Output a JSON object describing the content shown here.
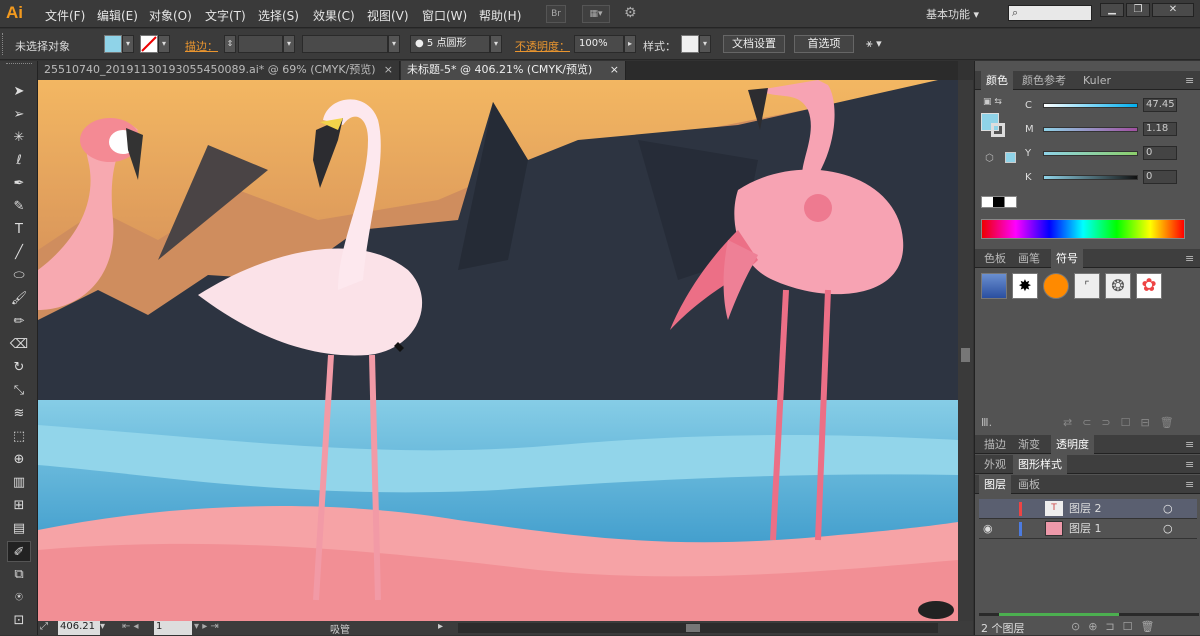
{
  "app": {
    "logo": "Ai",
    "workspace": "基本功能"
  },
  "menu": [
    "文件(F)",
    "编辑(E)",
    "对象(O)",
    "文字(T)",
    "选择(S)",
    "效果(C)",
    "视图(V)",
    "窗口(W)",
    "帮助(H)"
  ],
  "menubar_btn": "Br",
  "control": {
    "selection": "未选择对象",
    "stroke_label": "描边：",
    "brush": "5 点圆形",
    "opacity_label": "不透明度：",
    "opacity": "100%",
    "style_label": "样式：",
    "doc_setup": "文档设置",
    "prefs": "首选项"
  },
  "tabs": [
    {
      "label": "25510740_20191130193055450089.ai* @ 69% (CMYK/预览)"
    },
    {
      "label": "未标题-5* @ 406.21% (CMYK/预览)"
    }
  ],
  "status": {
    "zoom": "406.21",
    "page": "1",
    "tool": "吸管"
  },
  "color_panel": {
    "tabs": [
      "颜色",
      "颜色参考",
      "Kuler"
    ],
    "c": "47.45",
    "m": "1.18",
    "y": "0",
    "k": "0",
    "labels": [
      "C",
      "M",
      "Y",
      "K"
    ]
  },
  "swatch_panel": {
    "tabs": [
      "色板",
      "画笔",
      "符号"
    ]
  },
  "trans_panel": {
    "tabs": [
      "描边",
      "渐变",
      "透明度"
    ]
  },
  "appear_panel": {
    "tabs": [
      "外观",
      "图形样式"
    ]
  },
  "layers_panel": {
    "tabs": [
      "图层",
      "画板"
    ],
    "layers": [
      "图层 2",
      "图层 1"
    ],
    "count": "2 个图层"
  },
  "colors": {
    "accent": "#e9952f",
    "fill": "#8fd3e8"
  }
}
